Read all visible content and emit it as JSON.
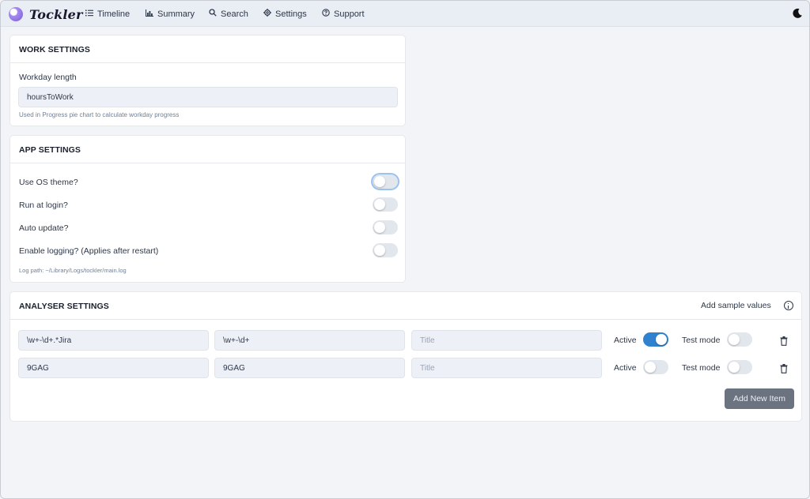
{
  "app": {
    "name": "Tockler"
  },
  "nav": {
    "items": [
      {
        "label": "Timeline",
        "icon": "list-icon"
      },
      {
        "label": "Summary",
        "icon": "bar-chart-icon"
      },
      {
        "label": "Search",
        "icon": "search-icon"
      },
      {
        "label": "Settings",
        "icon": "gear-icon"
      },
      {
        "label": "Support",
        "icon": "help-circle-icon"
      }
    ],
    "theme_icon": "moon-icon"
  },
  "work_settings": {
    "title": "WORK SETTINGS",
    "workday_label": "Workday length",
    "workday_value": "hoursToWork",
    "workday_hint": "Used in Progress pie chart to calculate workday progress"
  },
  "app_settings": {
    "title": "APP SETTINGS",
    "options": [
      {
        "label": "Use OS theme?",
        "enabled": false
      },
      {
        "label": "Run at login?",
        "enabled": false
      },
      {
        "label": "Auto update?",
        "enabled": false
      },
      {
        "label": "Enable logging? (Applies after restart)",
        "enabled": false
      }
    ],
    "log_path": "Log path: ~/Library/Logs/tockler/main.log"
  },
  "analyser_settings": {
    "title": "ANALYSER SETTINGS",
    "add_sample_label": "Add sample values",
    "active_label": "Active",
    "test_mode_label": "Test mode",
    "title_placeholder": "Title",
    "rows": [
      {
        "find_regex": "\\w+-\\d+.*Jira",
        "value_regex": "\\w+-\\d+",
        "title": "",
        "active": true,
        "test_mode": false
      },
      {
        "find_regex": "9GAG",
        "value_regex": "9GAG",
        "title": "",
        "active": false,
        "test_mode": false
      }
    ],
    "add_new_label": "Add New Item"
  },
  "colors": {
    "accent": "#3182ce",
    "toggle_off": "#e2e7ee",
    "button_bg": "#6b7381"
  }
}
